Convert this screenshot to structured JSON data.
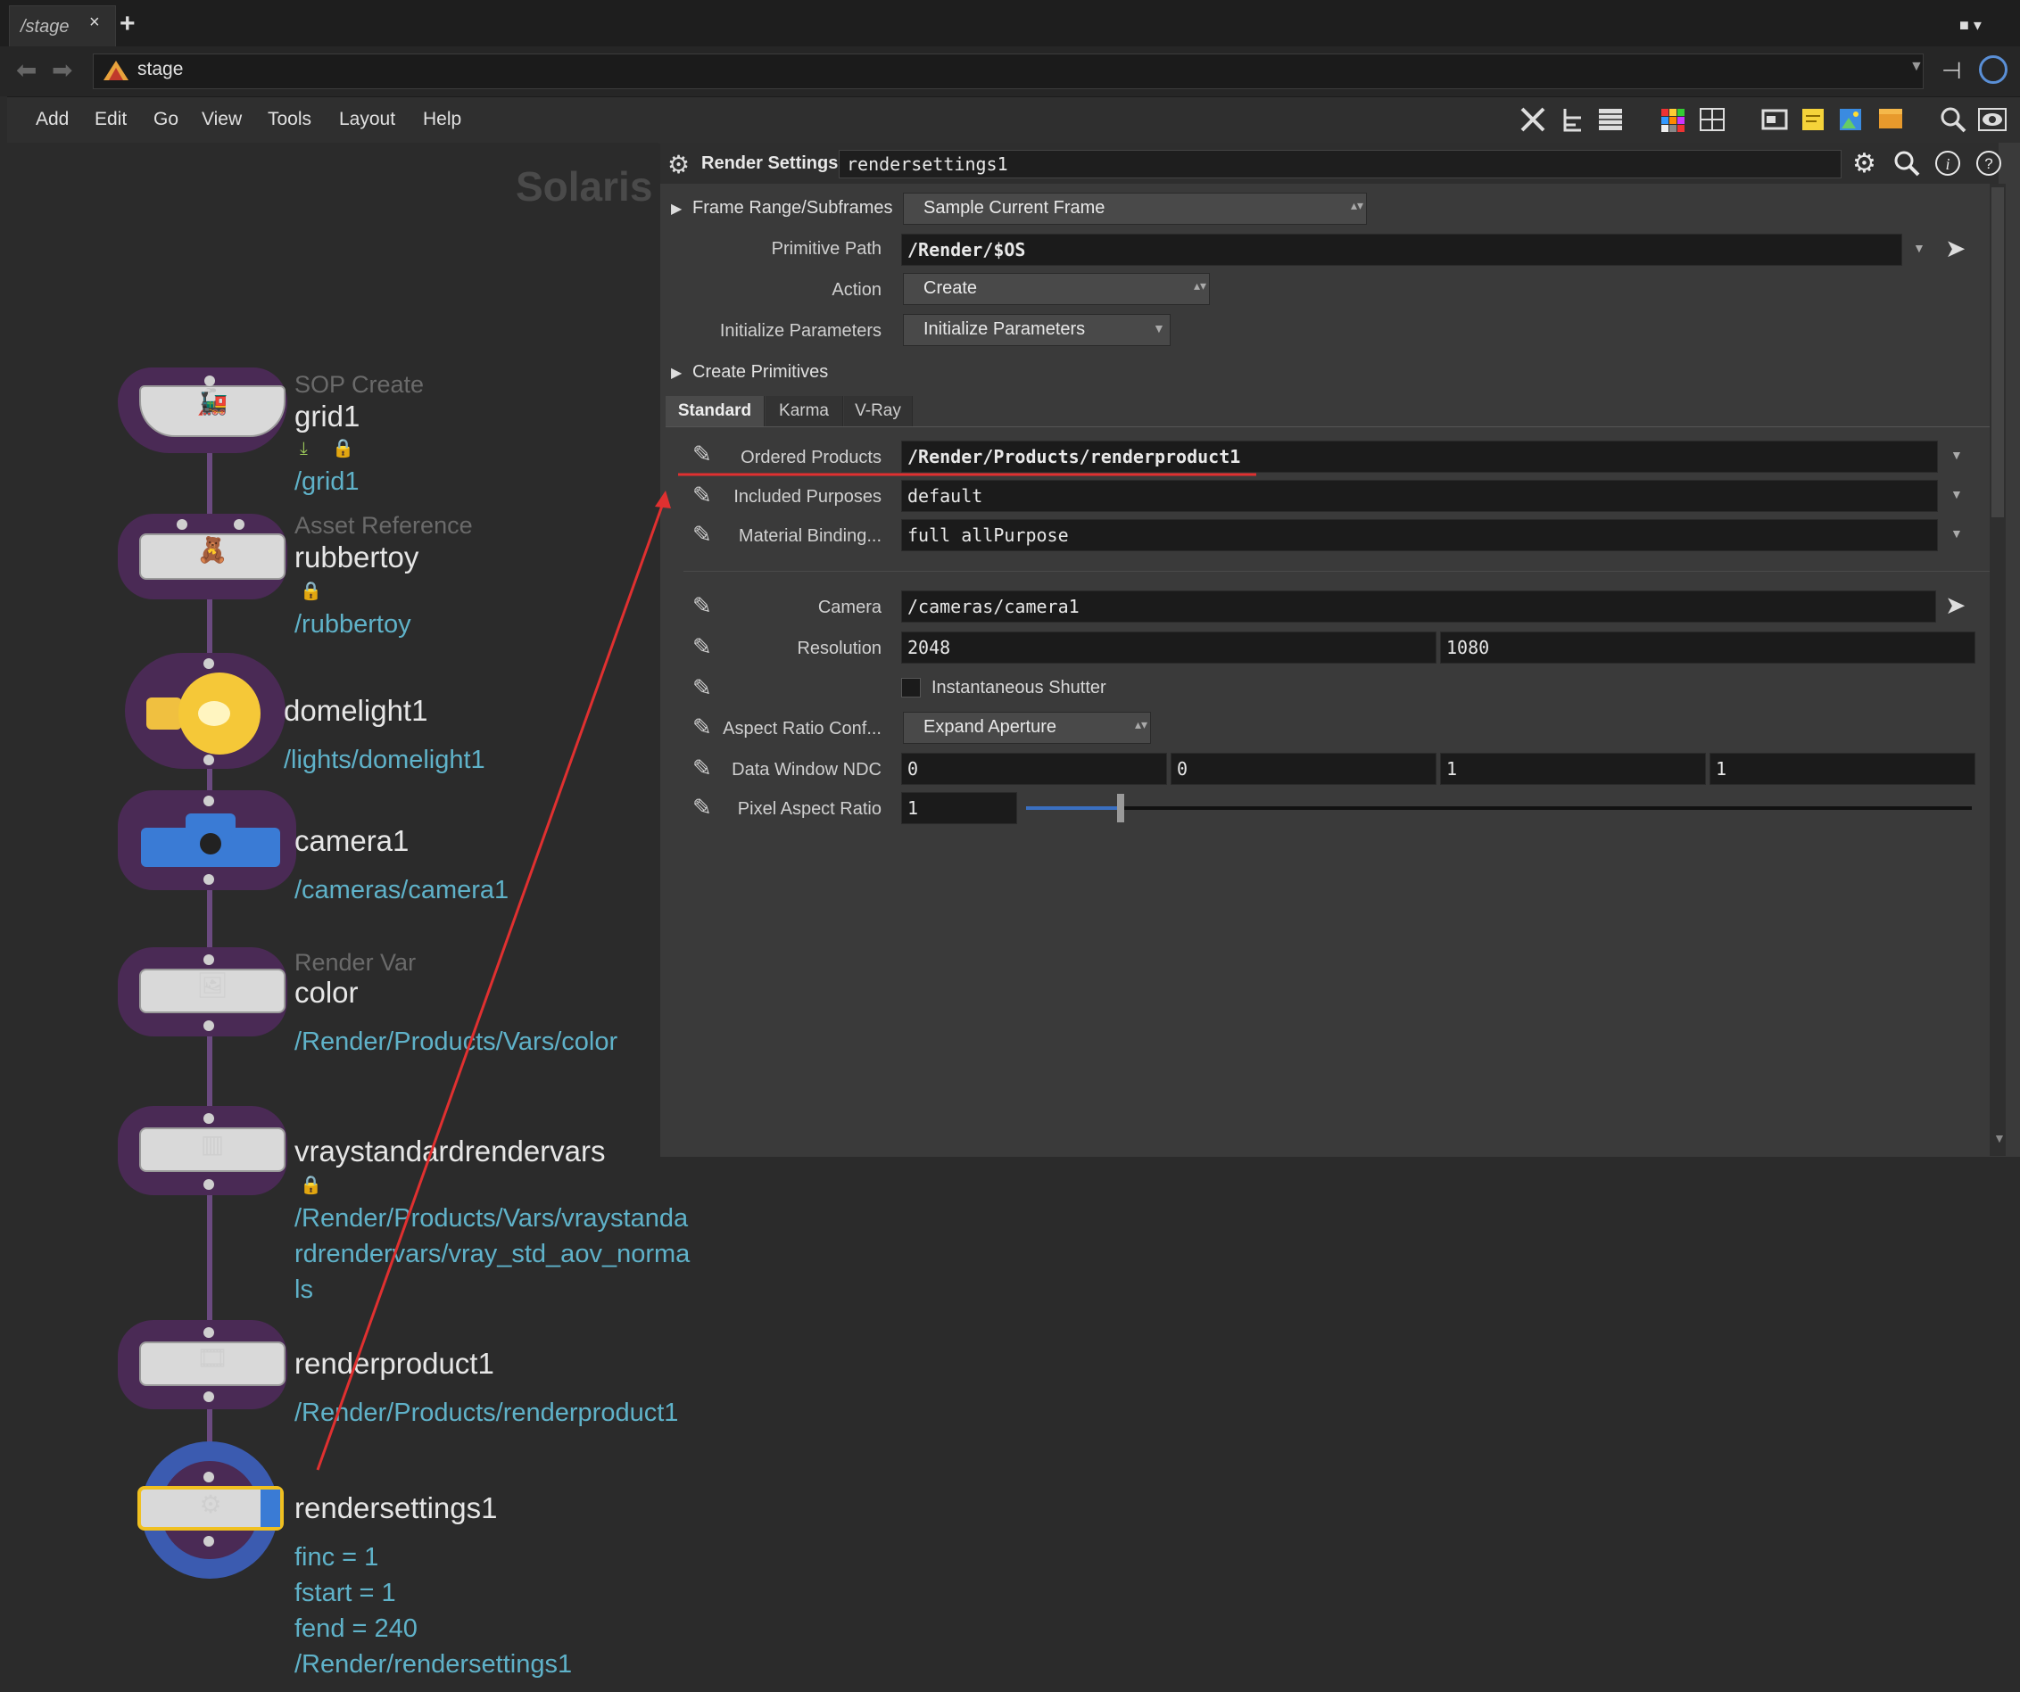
{
  "tabbar": {
    "tab_label": "/stage",
    "close": "×",
    "add": "+"
  },
  "pathbar": {
    "path": "stage"
  },
  "menu": {
    "items": [
      "Add",
      "Edit",
      "Go",
      "View",
      "Tools",
      "Layout",
      "Help"
    ]
  },
  "network": {
    "watermark": "Solaris",
    "nodes": [
      {
        "type": "SOP Create",
        "name": "grid1",
        "path": "/grid1",
        "icon": "toy-train-icon"
      },
      {
        "type": "Asset Reference",
        "name": "rubbertoy",
        "path": "/rubbertoy",
        "icon": "teddy-bear-icon"
      },
      {
        "type": "",
        "name": "domelight1",
        "path": "/lights/domelight1",
        "icon": "light-bulb-icon"
      },
      {
        "type": "",
        "name": "camera1",
        "path": "/cameras/camera1",
        "icon": "camera-icon"
      },
      {
        "type": "Render Var",
        "name": "color",
        "path": "/Render/Products/Vars/color",
        "icon": "portrait-icon"
      },
      {
        "type": "",
        "name": "vraystandardrendervars",
        "path_lines": [
          "/Render/Products/Vars/vraystanda",
          "rdrendervars/vray_std_aov_norma",
          "ls"
        ],
        "icon": "building-icon"
      },
      {
        "type": "",
        "name": "renderproduct1",
        "path": "/Render/Products/renderproduct1",
        "icon": "film-icon"
      },
      {
        "type": "",
        "name": "rendersettings1",
        "info": [
          "finc = 1",
          "fstart = 1",
          "fend = 240",
          "/Render/rendersettings1"
        ],
        "icon": "render-settings-icon"
      }
    ]
  },
  "params": {
    "node_type": "Render Settings",
    "node_name": "rendersettings1",
    "frame_range_label": "Frame Range/Subframes",
    "frame_range_value": "Sample Current Frame",
    "primitive_path_label": "Primitive Path",
    "primitive_path_value": "/Render/$OS",
    "action_label": "Action",
    "action_value": "Create",
    "init_label": "Initialize Parameters",
    "init_value": "Initialize Parameters",
    "create_prims_label": "Create Primitives",
    "tabs": [
      "Standard",
      "Karma",
      "V-Ray"
    ],
    "ordered_products_label": "Ordered Products",
    "ordered_products_value": "/Render/Products/renderproduct1",
    "included_purposes_label": "Included Purposes",
    "included_purposes_value": "default",
    "material_binding_label": "Material Binding...",
    "material_binding_value": "full allPurpose",
    "camera_label": "Camera",
    "camera_value": "/cameras/camera1",
    "resolution_label": "Resolution",
    "resolution_x": "2048",
    "resolution_y": "1080",
    "instantaneous_shutter_label": "Instantaneous Shutter",
    "instantaneous_shutter_checked": false,
    "aspect_conf_label": "Aspect Ratio Conf...",
    "aspect_conf_value": "Expand Aperture",
    "data_window_label": "Data Window NDC",
    "data_window_values": [
      "0",
      "0",
      "1",
      "1"
    ],
    "pixel_aspect_label": "Pixel Aspect Ratio",
    "pixel_aspect_value": "1",
    "pixel_aspect_slider_fraction": 0.1
  },
  "colors": {
    "accent_blue": "#3a7bd5",
    "path_cyan": "#5fb2c9",
    "annotation_red": "#e03030",
    "wire_purple": "#6b4a80",
    "selected_yellow": "#f0c020"
  }
}
